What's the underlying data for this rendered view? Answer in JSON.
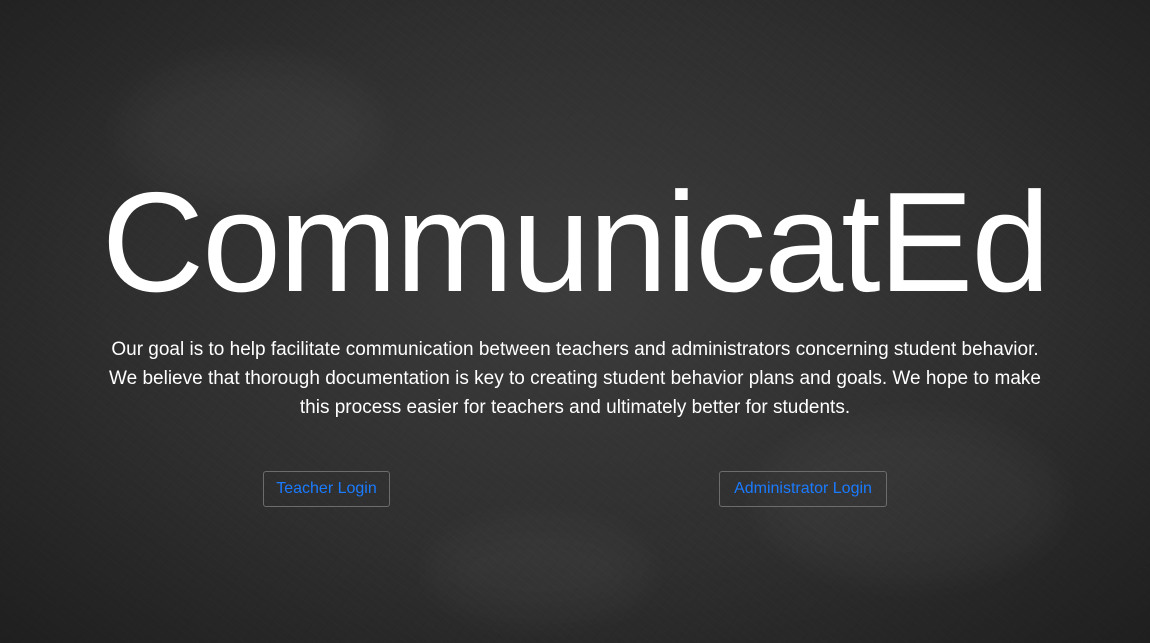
{
  "hero": {
    "title": "CommunicatEd",
    "description": "Our goal is to help facilitate communication between teachers and administrators concerning student behavior. We believe that thorough documentation is key to creating student behavior plans and goals. We hope to make this process easier for teachers and ultimately better for students."
  },
  "actions": {
    "teacher_login_label": "Teacher Login",
    "admin_login_label": "Administrator Login"
  },
  "colors": {
    "background": "#2f2f2f",
    "text": "#ffffff",
    "link": "#1a7bff",
    "button_border": "#6c6c6c"
  }
}
